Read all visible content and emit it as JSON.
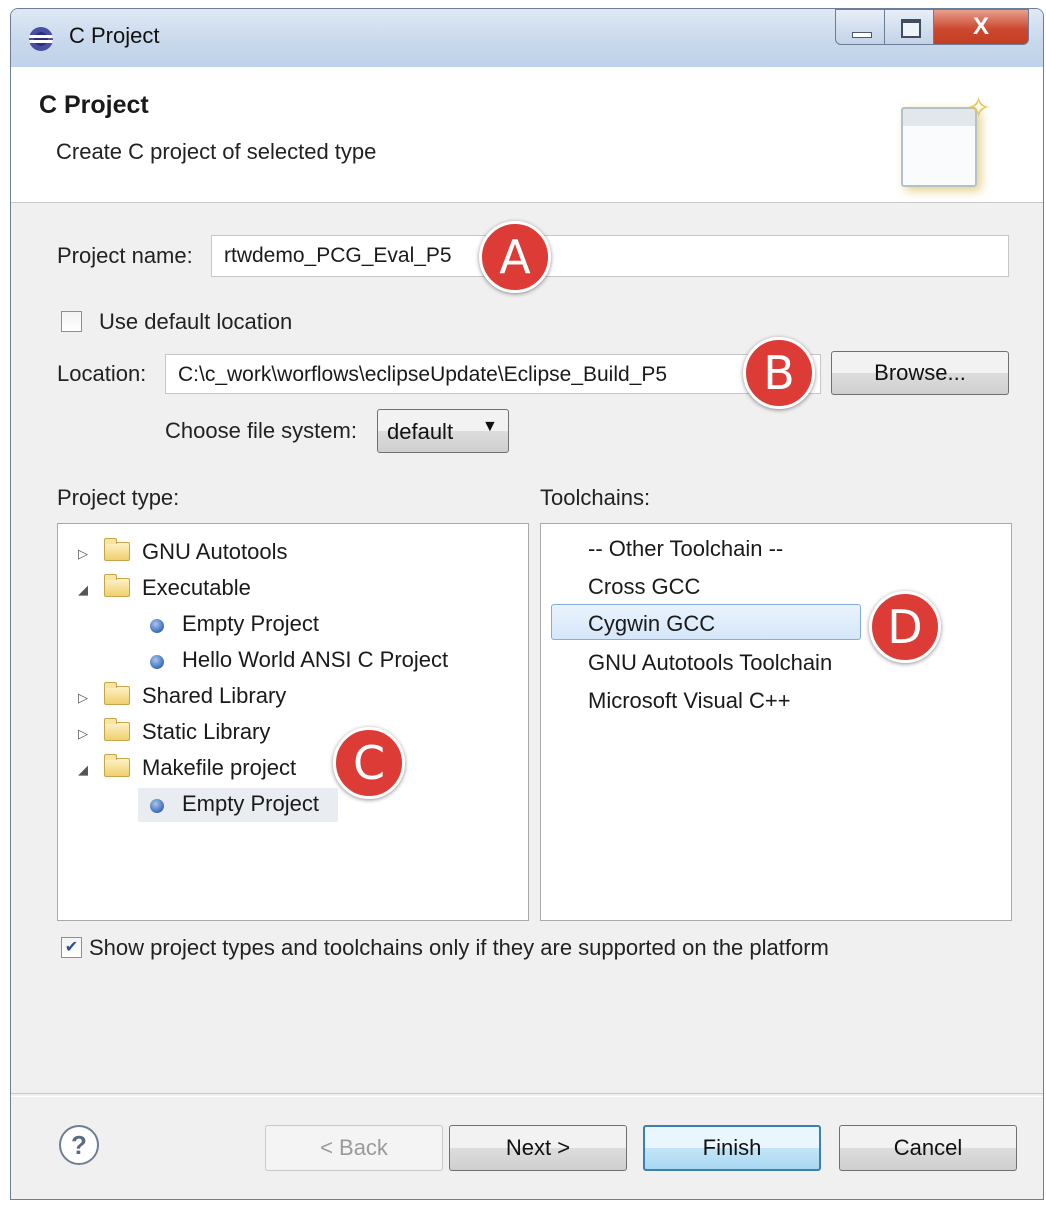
{
  "window": {
    "title": "C Project",
    "close_glyph": "X"
  },
  "banner": {
    "title": "C Project",
    "description": "Create C project of selected type"
  },
  "form": {
    "project_name_label": "Project name:",
    "project_name_value": "rtwdemo_PCG_Eval_P5",
    "use_default_location_label": "Use default location",
    "use_default_location_checked": false,
    "location_label": "Location:",
    "location_value": "C:\\c_work\\worflows\\eclipseUpdate\\Eclipse_Build_P5",
    "browse_label": "Browse...",
    "file_system_label": "Choose file system:",
    "file_system_value": "default"
  },
  "project_type": {
    "label": "Project type:",
    "items": [
      {
        "label": "GNU Autotools",
        "kind": "folder",
        "expanded": false
      },
      {
        "label": "Executable",
        "kind": "folder",
        "expanded": true
      },
      {
        "label": "Empty Project",
        "kind": "leaf"
      },
      {
        "label": "Hello World ANSI C Project",
        "kind": "leaf"
      },
      {
        "label": "Shared Library",
        "kind": "folder",
        "expanded": false
      },
      {
        "label": "Static Library",
        "kind": "folder",
        "expanded": false
      },
      {
        "label": "Makefile project",
        "kind": "folder",
        "expanded": true
      },
      {
        "label": "Empty Project",
        "kind": "leaf",
        "selected": true
      }
    ]
  },
  "toolchains": {
    "label": "Toolchains:",
    "items": [
      {
        "label": "-- Other Toolchain --"
      },
      {
        "label": "Cross GCC"
      },
      {
        "label": "Cygwin GCC",
        "selected": true
      },
      {
        "label": "GNU Autotools Toolchain"
      },
      {
        "label": "Microsoft Visual C++"
      }
    ]
  },
  "supported_only": {
    "label": "Show project types and toolchains only if they are supported on the platform",
    "checked": true
  },
  "buttons": {
    "help": "?",
    "back": "< Back",
    "next": "Next >",
    "finish": "Finish",
    "cancel": "Cancel"
  },
  "markers": {
    "a": "A",
    "b": "B",
    "c": "C",
    "d": "D"
  },
  "colors": {
    "marker": "#dc3b36",
    "selection": "#d5e7fa",
    "finish_border": "#3c7fb1"
  }
}
